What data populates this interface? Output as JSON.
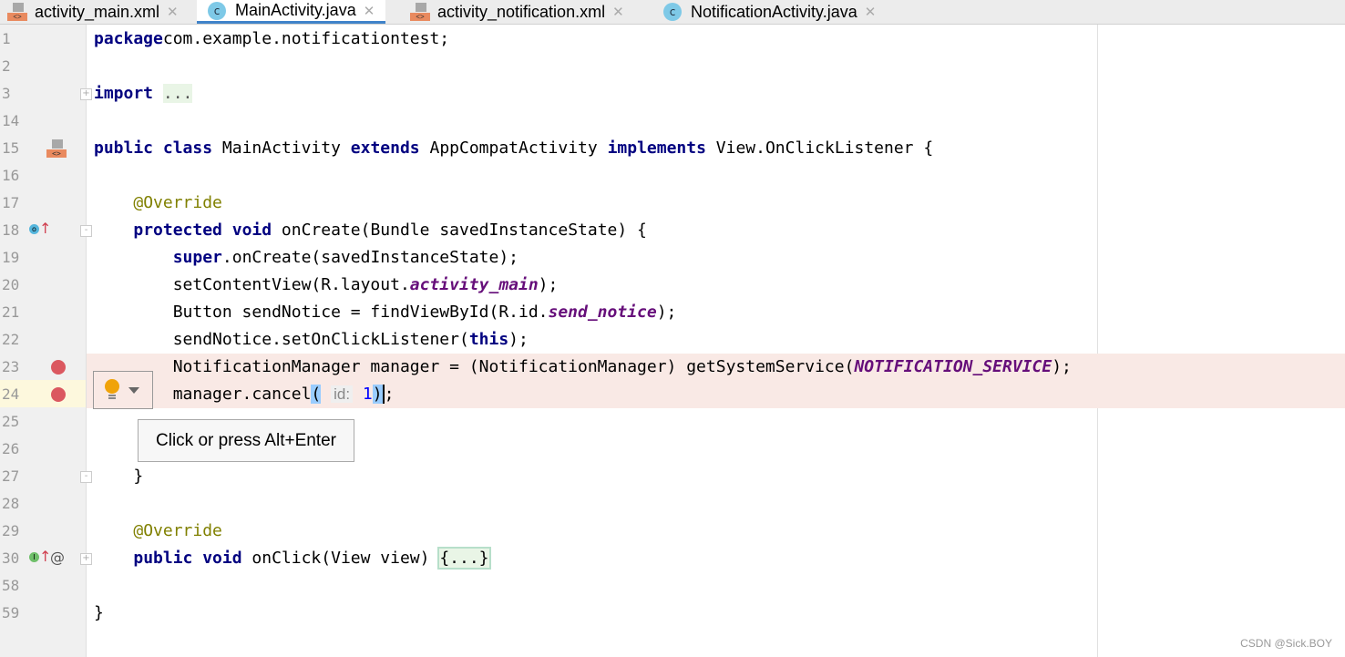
{
  "tabs": [
    {
      "label": "activity_main.xml",
      "icon": "xml-layout-icon",
      "active": false
    },
    {
      "label": "MainActivity.java",
      "icon": "java-class-icon",
      "active": true
    },
    {
      "label": "activity_notification.xml",
      "icon": "xml-layout-icon",
      "active": false
    },
    {
      "label": "NotificationActivity.java",
      "icon": "java-class-icon",
      "active": false
    }
  ],
  "editor": {
    "lines": [
      {
        "n": "1",
        "tokens": [
          [
            "kw",
            "package"
          ],
          [
            "",
            "com.example.notificationtest;"
          ]
        ]
      },
      {
        "n": "2",
        "tokens": []
      },
      {
        "n": "3",
        "tokens": [
          [
            "kw",
            "import"
          ],
          [
            "",
            " "
          ],
          [
            "fold",
            "..."
          ]
        ]
      },
      {
        "n": "14",
        "tokens": []
      },
      {
        "n": "15",
        "tokens": [
          [
            "kw",
            "public class "
          ],
          [
            "",
            "MainActivity "
          ],
          [
            "kw",
            "extends "
          ],
          [
            "",
            "AppCompatActivity "
          ],
          [
            "kw",
            "implements "
          ],
          [
            "",
            "View.OnClickListener {"
          ]
        ]
      },
      {
        "n": "16",
        "tokens": []
      },
      {
        "n": "17",
        "tokens": [
          [
            "",
            "    "
          ],
          [
            "ann",
            "@Override"
          ]
        ]
      },
      {
        "n": "18",
        "tokens": [
          [
            "",
            "    "
          ],
          [
            "kw",
            "protected void "
          ],
          [
            "",
            "onCreate(Bundle savedInstanceState) {"
          ]
        ]
      },
      {
        "n": "19",
        "tokens": [
          [
            "",
            "        "
          ],
          [
            "kw",
            "super"
          ],
          [
            "",
            ".onCreate(savedInstanceState);"
          ]
        ]
      },
      {
        "n": "20",
        "tokens": [
          [
            "",
            "        setContentView(R.layout."
          ],
          [
            "fld",
            "activity_main"
          ],
          [
            "",
            ");"
          ]
        ]
      },
      {
        "n": "21",
        "tokens": [
          [
            "",
            "        Button sendNotice = findViewById(R.id."
          ],
          [
            "fld",
            "send_notice"
          ],
          [
            "",
            ");"
          ]
        ]
      },
      {
        "n": "22",
        "tokens": [
          [
            "",
            "        sendNotice.setOnClickListener("
          ],
          [
            "kw",
            "this"
          ],
          [
            "",
            ");"
          ]
        ]
      },
      {
        "n": "23",
        "tokens": [
          [
            "",
            "        NotificationManager manager = (NotificationManager) getSystemService("
          ],
          [
            "fld",
            "NOTIFICATION_SERVICE"
          ],
          [
            "",
            ");"
          ]
        ]
      },
      {
        "n": "24",
        "tokens": [
          [
            "",
            "        manager.cancel"
          ],
          [
            "phl",
            "("
          ],
          [
            "hint",
            "id:"
          ],
          [
            "num",
            "1"
          ],
          [
            "phl",
            ")"
          ],
          [
            "caret",
            ";"
          ]
        ]
      },
      {
        "n": "25",
        "tokens": []
      },
      {
        "n": "26",
        "tokens": []
      },
      {
        "n": "27",
        "tokens": [
          [
            "",
            "    }"
          ]
        ]
      },
      {
        "n": "28",
        "tokens": []
      },
      {
        "n": "29",
        "tokens": [
          [
            "",
            "    "
          ],
          [
            "ann",
            "@Override"
          ]
        ]
      },
      {
        "n": "30",
        "tokens": [
          [
            "",
            "    "
          ],
          [
            "kw",
            "public void "
          ],
          [
            "",
            "onClick(View view) "
          ],
          [
            "foldbox",
            "{...}"
          ]
        ]
      },
      {
        "n": "58",
        "tokens": []
      },
      {
        "n": "59",
        "tokens": [
          [
            "",
            "}"
          ]
        ]
      }
    ],
    "breakpoint_lines": [
      "23",
      "24"
    ],
    "highlighted_lines": [
      "23",
      "24"
    ]
  },
  "intention": {
    "icon": "lightbulb-icon",
    "tooltip": "Click or press Alt+Enter"
  },
  "watermark": "CSDN @Sick.BOY"
}
